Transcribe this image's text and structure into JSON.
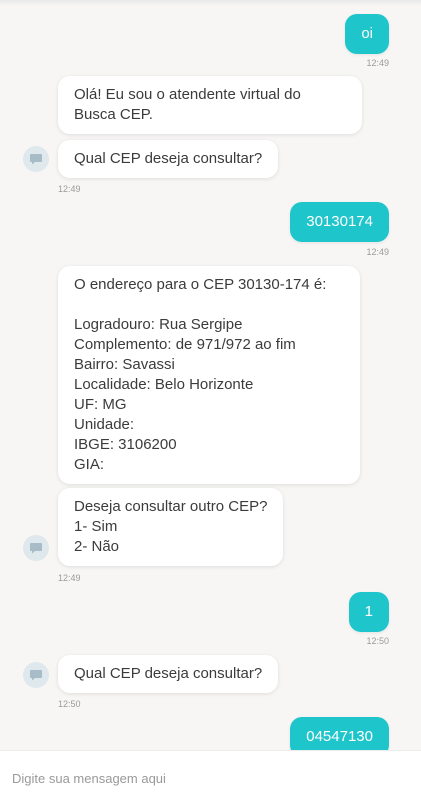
{
  "messages": [
    {
      "from": "user",
      "text": "oi",
      "time": "12:49"
    },
    {
      "from": "bot",
      "text": "Olá! Eu sou o atendente virtual do Busca CEP."
    },
    {
      "from": "bot",
      "text": "Qual CEP deseja consultar?",
      "time": "12:49"
    },
    {
      "from": "user",
      "text": "30130174",
      "time": "12:49"
    },
    {
      "from": "bot",
      "text": "O endereço para o CEP 30130-174 é:\n\nLogradouro: Rua Sergipe\nComplemento: de 971/972 ao fim\nBairro: Savassi\nLocalidade: Belo Horizonte\nUF: MG\nUnidade:\nIBGE: 3106200\nGIA:"
    },
    {
      "from": "bot",
      "text": "Deseja consultar outro CEP?\n1- Sim\n2- Não",
      "time": "12:49"
    },
    {
      "from": "user",
      "text": "1",
      "time": "12:50"
    },
    {
      "from": "bot",
      "text": "Qual CEP deseja consultar?",
      "time": "12:50"
    },
    {
      "from": "user",
      "text": "04547130"
    }
  ],
  "composer": {
    "placeholder": "Digite sua mensagem aqui"
  },
  "colors": {
    "user_bubble": "#1ec6cc",
    "bot_bubble": "#ffffff",
    "background": "#f7f6f5"
  },
  "icons": {
    "bot_avatar": "chat-bubble-icon"
  }
}
